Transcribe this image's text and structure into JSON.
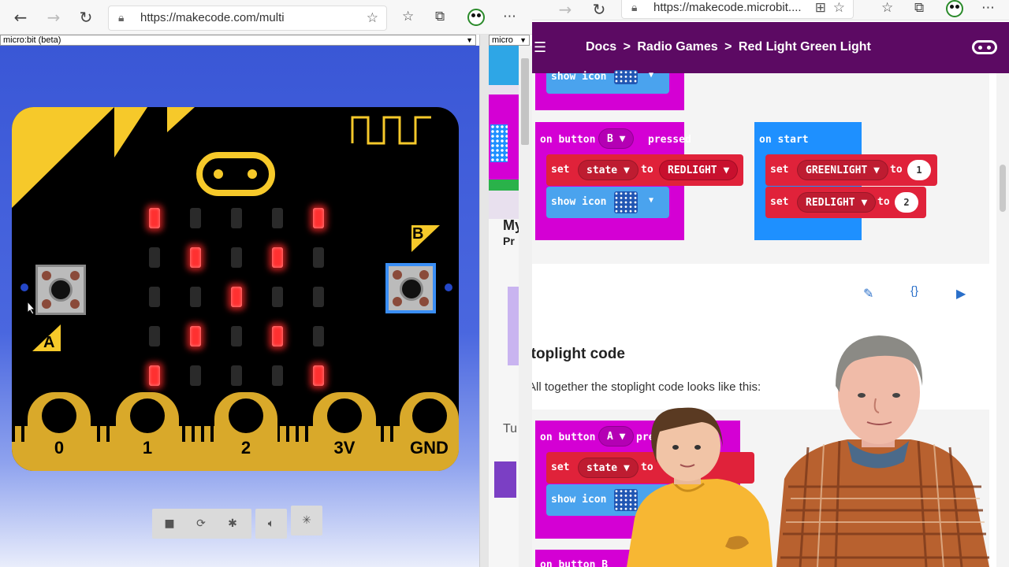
{
  "left_browser": {
    "url": "https://makecode.com/multi",
    "sim_select": "micro:bit (beta)",
    "editor_select": "micro",
    "pins": [
      "0",
      "1",
      "2",
      "3V",
      "GND"
    ],
    "button_a": "A",
    "button_b": "B",
    "editor_peek": {
      "line1": "My",
      "line2": "Pr",
      "line3": "Tu"
    },
    "led_matrix": [
      [
        1,
        0,
        0,
        0,
        1
      ],
      [
        0,
        1,
        0,
        1,
        0
      ],
      [
        0,
        0,
        1,
        0,
        0
      ],
      [
        0,
        1,
        0,
        1,
        0
      ],
      [
        1,
        0,
        0,
        0,
        1
      ]
    ]
  },
  "right_browser": {
    "url": "https://makecode.microbit....",
    "breadcrumb": {
      "docs": "Docs",
      "sep1": ">",
      "radio_games": "Radio Games",
      "sep2": ">",
      "current": "Red Light Green Light"
    },
    "card1": {
      "show_icon_top": "show icon",
      "on_button_b": {
        "on": "on button",
        "btn": "B",
        "pressed": "pressed"
      },
      "set_state": {
        "set": "set",
        "var": "state",
        "to": "to",
        "value": "REDLIGHT"
      },
      "show_icon": "show icon",
      "on_start": "on start",
      "set_green": {
        "set": "set",
        "var": "GREENLIGHT",
        "to": "to",
        "value": "1"
      },
      "set_red": {
        "set": "set",
        "var": "REDLIGHT",
        "to": "to",
        "value": "2"
      }
    },
    "actions": {
      "edit": "✎",
      "code": "{}",
      "run": "▶"
    },
    "heading": "Stoplight code",
    "paragraph": "All together the stoplight code looks like this:",
    "card2": {
      "on_button_a": {
        "on": "on button",
        "btn": "A",
        "pressed": "pressed"
      },
      "set_state": {
        "set": "set",
        "var": "state",
        "to": "to"
      },
      "show_icon": "show icon",
      "bottom_peek": "on button B"
    }
  },
  "colors": {
    "makecode_purple": "#5c0a63",
    "block_magenta": "#d400d4",
    "block_red": "#e0223a",
    "block_blue": "#1e90ff",
    "sim_blue": "#3a57d6"
  }
}
